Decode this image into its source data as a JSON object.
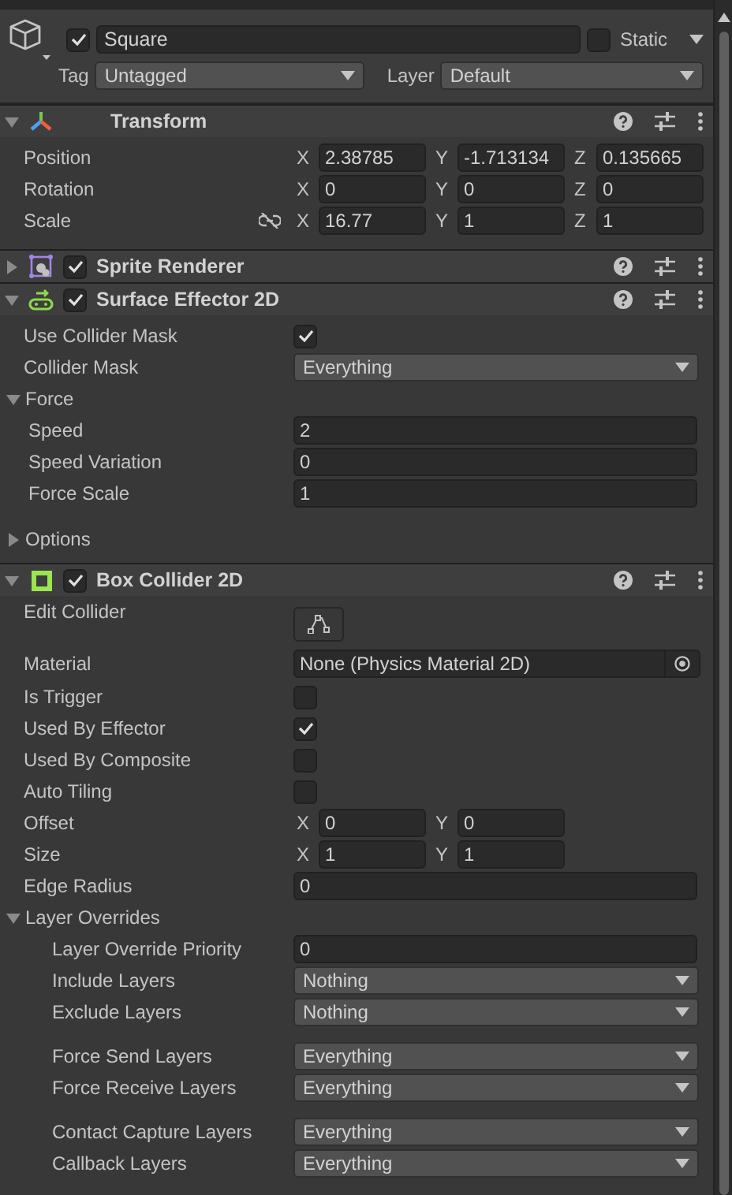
{
  "object": {
    "active": true,
    "name": "Square",
    "static_label": "Static",
    "static": false,
    "tag_label": "Tag",
    "tag": "Untagged",
    "layer_label": "Layer",
    "layer": "Default"
  },
  "components": [
    {
      "kind": "transform",
      "title": "Transform",
      "expanded": true,
      "rows": [
        {
          "kind": "vector",
          "label": "Position",
          "axes": [
            {
              "axis": "X",
              "value": "2.38785"
            },
            {
              "axis": "Y",
              "value": "-1.713134"
            },
            {
              "axis": "Z",
              "value": "0.135665"
            }
          ]
        },
        {
          "kind": "vector",
          "label": "Rotation",
          "axes": [
            {
              "axis": "X",
              "value": "0"
            },
            {
              "axis": "Y",
              "value": "0"
            },
            {
              "axis": "Z",
              "value": "0"
            }
          ]
        },
        {
          "kind": "vector",
          "label": "Scale",
          "proportions_locked": false,
          "axes": [
            {
              "axis": "X",
              "value": "16.77"
            },
            {
              "axis": "Y",
              "value": "1"
            },
            {
              "axis": "Z",
              "value": "1"
            }
          ]
        }
      ]
    },
    {
      "kind": "sprite",
      "title": "Sprite Renderer",
      "expanded": false,
      "enabled": true
    },
    {
      "kind": "effector",
      "title": "Surface Effector 2D",
      "expanded": true,
      "enabled": true,
      "rows": [
        {
          "kind": "checkbox",
          "label": "Use Collider Mask",
          "checked": true
        },
        {
          "kind": "dropdown",
          "label": "Collider Mask",
          "value": "Everything"
        },
        {
          "kind": "foldout",
          "label": "Force",
          "expanded": true,
          "children": [
            [
              {
                "kind": "field",
                "label": "Speed",
                "value": "2"
              },
              {
                "kind": "field",
                "label": "Speed Variation",
                "value": "0"
              },
              {
                "kind": "field",
                "label": "Force Scale",
                "value": "1"
              }
            ]
          ]
        },
        {
          "kind": "foldout",
          "label": "Options",
          "expanded": false
        }
      ]
    },
    {
      "kind": "collider",
      "title": "Box Collider 2D",
      "expanded": true,
      "enabled": true,
      "rows": [
        {
          "kind": "button",
          "label": "Edit Collider"
        },
        {
          "kind": "object",
          "label": "Material",
          "value": "None (Physics Material 2D)"
        },
        {
          "kind": "checkbox",
          "label": "Is Trigger",
          "checked": false
        },
        {
          "kind": "checkbox",
          "label": "Used By Effector",
          "checked": true
        },
        {
          "kind": "checkbox",
          "label": "Used By Composite",
          "checked": false
        },
        {
          "kind": "checkbox",
          "label": "Auto Tiling",
          "checked": false
        },
        {
          "kind": "vector",
          "label": "Offset",
          "axes": [
            {
              "axis": "X",
              "value": "0"
            },
            {
              "axis": "Y",
              "value": "0"
            }
          ]
        },
        {
          "kind": "vector",
          "label": "Size",
          "axes": [
            {
              "axis": "X",
              "value": "1"
            },
            {
              "axis": "Y",
              "value": "1"
            }
          ]
        },
        {
          "kind": "field",
          "label": "Edge Radius",
          "value": "0"
        },
        {
          "kind": "foldout",
          "label": "Layer Overrides",
          "expanded": true,
          "children": [
            [
              {
                "kind": "field",
                "label": "Layer Override Priority",
                "value": "0"
              },
              {
                "kind": "dropdown",
                "label": "Include Layers",
                "value": "Nothing"
              },
              {
                "kind": "dropdown",
                "label": "Exclude Layers",
                "value": "Nothing"
              }
            ],
            [
              {
                "kind": "dropdown",
                "label": "Force Send Layers",
                "value": "Everything"
              },
              {
                "kind": "dropdown",
                "label": "Force Receive Layers",
                "value": "Everything"
              }
            ],
            [
              {
                "kind": "dropdown",
                "label": "Contact Capture Layers",
                "value": "Everything"
              },
              {
                "kind": "dropdown",
                "label": "Callback Layers",
                "value": "Everything"
              }
            ]
          ]
        }
      ]
    }
  ]
}
